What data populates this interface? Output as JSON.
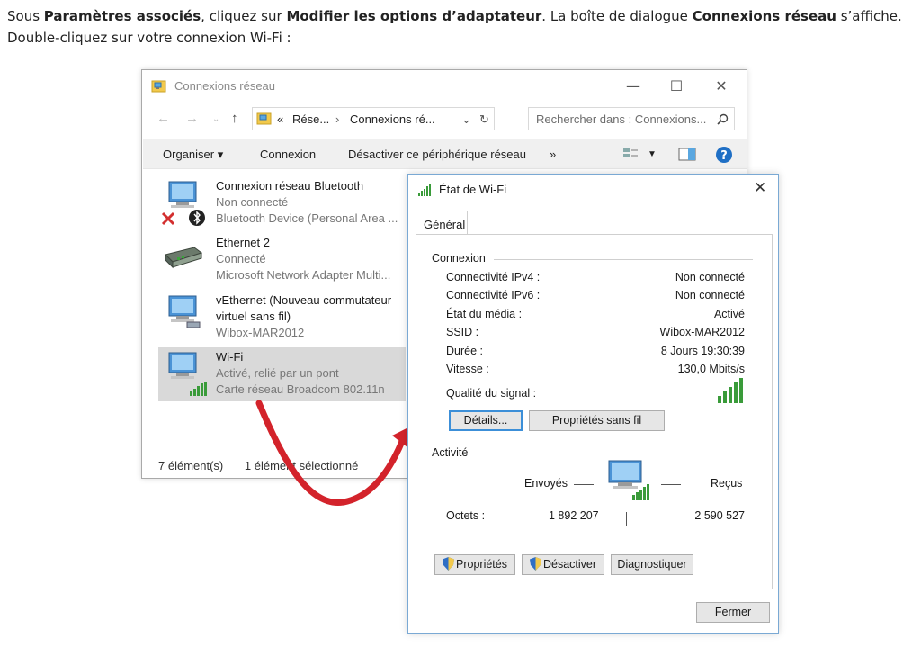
{
  "intro": {
    "t1": "Sous ",
    "b1": "Paramètres associés",
    "t2": ", cliquez sur ",
    "b2": "Modifier les options d’adaptateur",
    "t3": ". La boîte de dialogue ",
    "b3": "Connexions réseau",
    "t4": " s’affiche. Double-cliquez sur votre connexion Wi-Fi :"
  },
  "explorer": {
    "title": "Connexions réseau",
    "breadcrumb": {
      "prefix": "«",
      "part1": "Rése...",
      "sep": "›",
      "part2": "Connexions ré..."
    },
    "search_placeholder": "Rechercher dans : Connexions...",
    "commands": {
      "organize": "Organiser",
      "connect": "Connexion",
      "disable": "Désactiver ce périphérique réseau",
      "more": "»"
    },
    "items": [
      {
        "name": "Connexion réseau Bluetooth",
        "status": "Non connecté",
        "device": "Bluetooth Device (Personal Area ..."
      },
      {
        "name": "Ethernet 2",
        "status": "Connecté",
        "device": "Microsoft Network Adapter Multi..."
      },
      {
        "name": "vEthernet (Nouveau commutateur",
        "name2": "virtuel sans fil)",
        "device": "Wibox-MAR2012"
      },
      {
        "name": "Wi-Fi",
        "status": "Activé, relié par un pont",
        "device": "Carte réseau Broadcom 802.11n"
      }
    ],
    "status": {
      "count": "7 élément(s)",
      "selected": "1 élément sélectionné"
    }
  },
  "dialog": {
    "title": "État de Wi-Fi",
    "tab": "Général",
    "connection": {
      "title": "Connexion",
      "rows": [
        {
          "label": "Connectivité IPv4 :",
          "value": "Non connecté"
        },
        {
          "label": "Connectivité IPv6 :",
          "value": "Non connecté"
        },
        {
          "label": "État du média :",
          "value": "Activé"
        },
        {
          "label": "SSID :",
          "value": "Wibox-MAR2012"
        },
        {
          "label": "Durée :",
          "value": "8 Jours 19:30:39"
        },
        {
          "label": "Vitesse :",
          "value": "130,0 Mbits/s"
        }
      ],
      "signal_label": "Qualité du signal :",
      "signal_bars": 5
    },
    "buttons": {
      "details": "Détails...",
      "wireless": "Propriétés sans fil"
    },
    "activity": {
      "title": "Activité",
      "sent": "Envoyés",
      "received": "Reçus",
      "bytes_label": "Octets :",
      "bytes_sent": "1 892 207",
      "bytes_received": "2 590 527"
    },
    "actions": {
      "properties": "Propriétés",
      "disable": "Désactiver",
      "diagnose": "Diagnostiquer"
    },
    "close": "Fermer"
  },
  "colors": {
    "accent": "#3c8fd8",
    "arrow": "#d3232b",
    "selection": "#d9d9d9",
    "signal": "#3a9b3a"
  }
}
